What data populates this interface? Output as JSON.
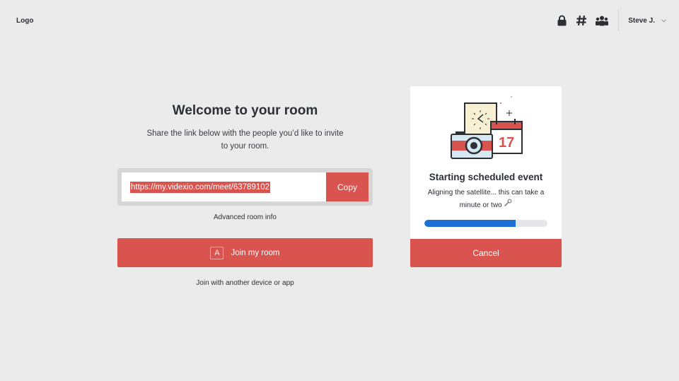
{
  "header": {
    "logo": "Logo",
    "icons": [
      "lock-icon",
      "hash-icon",
      "group-icon"
    ],
    "user_name": "Steve J."
  },
  "welcome": {
    "title": "Welcome to your room",
    "subtitle": "Share the link below with the people you’d like to invite to your room.",
    "link": "https://my.videxio.com/meet/63789102",
    "copy_label": "Copy",
    "advanced_label": "Advanced room info",
    "join_badge": "A",
    "join_label": "Join my room",
    "join_other_label": "Join with another device or app"
  },
  "event_card": {
    "calendar_day": "17",
    "title": "Starting scheduled event",
    "subtitle": "Aligning the satellite... this can take a minute or two",
    "progress_percent": 74,
    "cancel_label": "Cancel"
  },
  "colors": {
    "accent": "#d9534f",
    "progress": "#1d6fd6",
    "background": "#ebebeb"
  }
}
